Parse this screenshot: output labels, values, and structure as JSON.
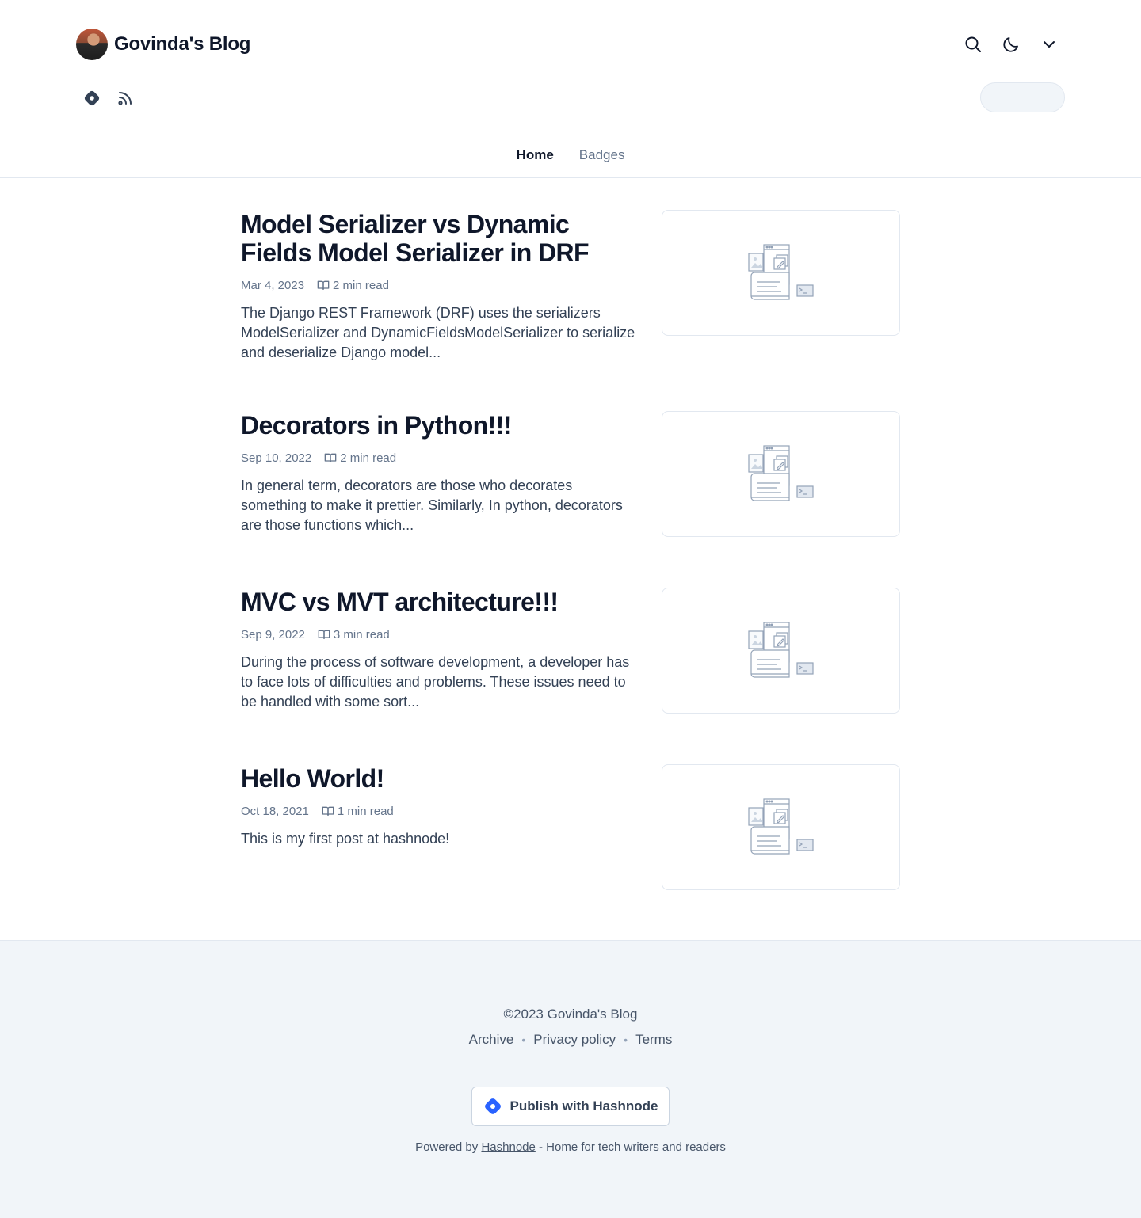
{
  "header": {
    "blog_title": "Govinda's Blog",
    "icons": [
      "search-icon",
      "moon-icon",
      "chevron-down-icon"
    ],
    "social_icons": [
      "hashnode-icon",
      "rss-icon"
    ]
  },
  "nav": {
    "items": [
      {
        "label": "Home",
        "active": true
      },
      {
        "label": "Badges",
        "active": false
      }
    ]
  },
  "posts": [
    {
      "title": "Model Serializer vs Dynamic Fields Model Serializer in DRF",
      "date": "Mar 4, 2023",
      "read_time": "2 min read",
      "excerpt": "The Django REST Framework (DRF) uses the serializers ModelSerializer and DynamicFieldsModelSerializer to serialize and deserialize Django model..."
    },
    {
      "title": "Decorators in Python!!!",
      "date": "Sep 10, 2022",
      "read_time": "2 min read",
      "excerpt": "In general term, decorators are those who decorates something to make it prettier. Similarly, In python, decorators are those functions which..."
    },
    {
      "title": "MVC vs MVT architecture!!!",
      "date": "Sep 9, 2022",
      "read_time": "3 min read",
      "excerpt": "During the process of software development, a developer has to face lots of difficulties and problems. These issues need to be handled with some sort..."
    },
    {
      "title": "Hello World!",
      "date": "Oct 18, 2021",
      "read_time": "1 min read",
      "excerpt": "This is my first post at hashnode!"
    }
  ],
  "footer": {
    "copyright": "©2023 Govinda's Blog",
    "links": [
      "Archive",
      "Privacy policy",
      "Terms"
    ],
    "publish_label": "Publish with Hashnode",
    "powered_prefix": "Powered by",
    "powered_link": "Hashnode",
    "powered_suffix": "- Home for tech writers and readers"
  },
  "colors": {
    "text_primary": "#0f172a",
    "text_muted": "#64748b",
    "footer_bg": "#f1f5f9",
    "hashnode_blue": "#2962ff"
  }
}
